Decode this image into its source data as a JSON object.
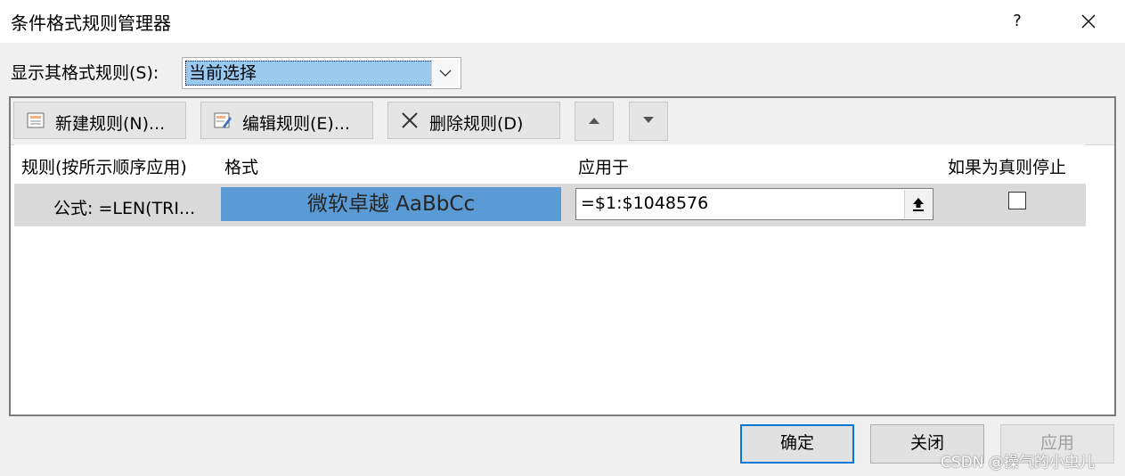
{
  "window": {
    "title": "条件格式规则管理器",
    "help_label": "?",
    "close_icon": "close-icon"
  },
  "show_rules": {
    "label": "显示其格式规则(S):",
    "selected": "当前选择"
  },
  "toolbar": {
    "new_rule": "新建规则(N)...",
    "edit_rule": "编辑规则(E)...",
    "delete_rule": "删除规则(D)",
    "move_up_icon": "triangle-up-icon",
    "move_down_icon": "triangle-down-icon"
  },
  "table": {
    "headers": [
      "规则(按所示顺序应用)",
      "格式",
      "应用于",
      "如果为真则停止"
    ],
    "rows": [
      {
        "rule": "公式: =LEN(TRI...",
        "format_preview": "微软卓越  AaBbCc",
        "format_fill": "#5b9bd5",
        "applies_to": "=$1:$1048576",
        "stop_if_true": false
      }
    ]
  },
  "footer": {
    "ok": "确定",
    "close": "关闭",
    "apply": "应用"
  },
  "watermark": "CSDN @操气的小虫儿",
  "colors": {
    "accent": "#0078d7",
    "selection": "#99c9ef"
  }
}
